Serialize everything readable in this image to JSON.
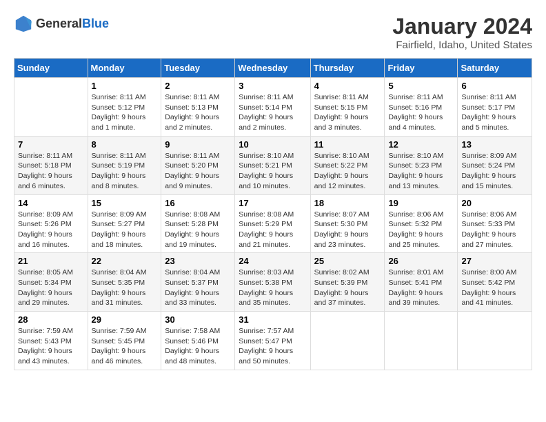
{
  "header": {
    "logo_general": "General",
    "logo_blue": "Blue",
    "main_title": "January 2024",
    "subtitle": "Fairfield, Idaho, United States"
  },
  "calendar": {
    "days_of_week": [
      "Sunday",
      "Monday",
      "Tuesday",
      "Wednesday",
      "Thursday",
      "Friday",
      "Saturday"
    ],
    "weeks": [
      [
        {
          "day": "",
          "sunrise": "",
          "sunset": "",
          "daylight": ""
        },
        {
          "day": "1",
          "sunrise": "Sunrise: 8:11 AM",
          "sunset": "Sunset: 5:12 PM",
          "daylight": "Daylight: 9 hours and 1 minute."
        },
        {
          "day": "2",
          "sunrise": "Sunrise: 8:11 AM",
          "sunset": "Sunset: 5:13 PM",
          "daylight": "Daylight: 9 hours and 2 minutes."
        },
        {
          "day": "3",
          "sunrise": "Sunrise: 8:11 AM",
          "sunset": "Sunset: 5:14 PM",
          "daylight": "Daylight: 9 hours and 2 minutes."
        },
        {
          "day": "4",
          "sunrise": "Sunrise: 8:11 AM",
          "sunset": "Sunset: 5:15 PM",
          "daylight": "Daylight: 9 hours and 3 minutes."
        },
        {
          "day": "5",
          "sunrise": "Sunrise: 8:11 AM",
          "sunset": "Sunset: 5:16 PM",
          "daylight": "Daylight: 9 hours and 4 minutes."
        },
        {
          "day": "6",
          "sunrise": "Sunrise: 8:11 AM",
          "sunset": "Sunset: 5:17 PM",
          "daylight": "Daylight: 9 hours and 5 minutes."
        }
      ],
      [
        {
          "day": "7",
          "sunrise": "Sunrise: 8:11 AM",
          "sunset": "Sunset: 5:18 PM",
          "daylight": "Daylight: 9 hours and 6 minutes."
        },
        {
          "day": "8",
          "sunrise": "Sunrise: 8:11 AM",
          "sunset": "Sunset: 5:19 PM",
          "daylight": "Daylight: 9 hours and 8 minutes."
        },
        {
          "day": "9",
          "sunrise": "Sunrise: 8:11 AM",
          "sunset": "Sunset: 5:20 PM",
          "daylight": "Daylight: 9 hours and 9 minutes."
        },
        {
          "day": "10",
          "sunrise": "Sunrise: 8:10 AM",
          "sunset": "Sunset: 5:21 PM",
          "daylight": "Daylight: 9 hours and 10 minutes."
        },
        {
          "day": "11",
          "sunrise": "Sunrise: 8:10 AM",
          "sunset": "Sunset: 5:22 PM",
          "daylight": "Daylight: 9 hours and 12 minutes."
        },
        {
          "day": "12",
          "sunrise": "Sunrise: 8:10 AM",
          "sunset": "Sunset: 5:23 PM",
          "daylight": "Daylight: 9 hours and 13 minutes."
        },
        {
          "day": "13",
          "sunrise": "Sunrise: 8:09 AM",
          "sunset": "Sunset: 5:24 PM",
          "daylight": "Daylight: 9 hours and 15 minutes."
        }
      ],
      [
        {
          "day": "14",
          "sunrise": "Sunrise: 8:09 AM",
          "sunset": "Sunset: 5:26 PM",
          "daylight": "Daylight: 9 hours and 16 minutes."
        },
        {
          "day": "15",
          "sunrise": "Sunrise: 8:09 AM",
          "sunset": "Sunset: 5:27 PM",
          "daylight": "Daylight: 9 hours and 18 minutes."
        },
        {
          "day": "16",
          "sunrise": "Sunrise: 8:08 AM",
          "sunset": "Sunset: 5:28 PM",
          "daylight": "Daylight: 9 hours and 19 minutes."
        },
        {
          "day": "17",
          "sunrise": "Sunrise: 8:08 AM",
          "sunset": "Sunset: 5:29 PM",
          "daylight": "Daylight: 9 hours and 21 minutes."
        },
        {
          "day": "18",
          "sunrise": "Sunrise: 8:07 AM",
          "sunset": "Sunset: 5:30 PM",
          "daylight": "Daylight: 9 hours and 23 minutes."
        },
        {
          "day": "19",
          "sunrise": "Sunrise: 8:06 AM",
          "sunset": "Sunset: 5:32 PM",
          "daylight": "Daylight: 9 hours and 25 minutes."
        },
        {
          "day": "20",
          "sunrise": "Sunrise: 8:06 AM",
          "sunset": "Sunset: 5:33 PM",
          "daylight": "Daylight: 9 hours and 27 minutes."
        }
      ],
      [
        {
          "day": "21",
          "sunrise": "Sunrise: 8:05 AM",
          "sunset": "Sunset: 5:34 PM",
          "daylight": "Daylight: 9 hours and 29 minutes."
        },
        {
          "day": "22",
          "sunrise": "Sunrise: 8:04 AM",
          "sunset": "Sunset: 5:35 PM",
          "daylight": "Daylight: 9 hours and 31 minutes."
        },
        {
          "day": "23",
          "sunrise": "Sunrise: 8:04 AM",
          "sunset": "Sunset: 5:37 PM",
          "daylight": "Daylight: 9 hours and 33 minutes."
        },
        {
          "day": "24",
          "sunrise": "Sunrise: 8:03 AM",
          "sunset": "Sunset: 5:38 PM",
          "daylight": "Daylight: 9 hours and 35 minutes."
        },
        {
          "day": "25",
          "sunrise": "Sunrise: 8:02 AM",
          "sunset": "Sunset: 5:39 PM",
          "daylight": "Daylight: 9 hours and 37 minutes."
        },
        {
          "day": "26",
          "sunrise": "Sunrise: 8:01 AM",
          "sunset": "Sunset: 5:41 PM",
          "daylight": "Daylight: 9 hours and 39 minutes."
        },
        {
          "day": "27",
          "sunrise": "Sunrise: 8:00 AM",
          "sunset": "Sunset: 5:42 PM",
          "daylight": "Daylight: 9 hours and 41 minutes."
        }
      ],
      [
        {
          "day": "28",
          "sunrise": "Sunrise: 7:59 AM",
          "sunset": "Sunset: 5:43 PM",
          "daylight": "Daylight: 9 hours and 43 minutes."
        },
        {
          "day": "29",
          "sunrise": "Sunrise: 7:59 AM",
          "sunset": "Sunset: 5:45 PM",
          "daylight": "Daylight: 9 hours and 46 minutes."
        },
        {
          "day": "30",
          "sunrise": "Sunrise: 7:58 AM",
          "sunset": "Sunset: 5:46 PM",
          "daylight": "Daylight: 9 hours and 48 minutes."
        },
        {
          "day": "31",
          "sunrise": "Sunrise: 7:57 AM",
          "sunset": "Sunset: 5:47 PM",
          "daylight": "Daylight: 9 hours and 50 minutes."
        },
        {
          "day": "",
          "sunrise": "",
          "sunset": "",
          "daylight": ""
        },
        {
          "day": "",
          "sunrise": "",
          "sunset": "",
          "daylight": ""
        },
        {
          "day": "",
          "sunrise": "",
          "sunset": "",
          "daylight": ""
        }
      ]
    ]
  }
}
